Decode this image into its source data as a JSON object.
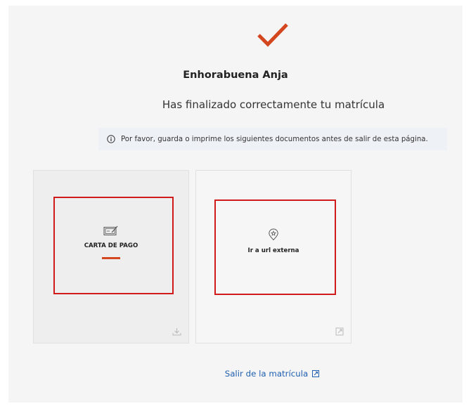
{
  "header": {
    "check_icon": "check-icon",
    "title": "Enhorabuena Anja",
    "subtitle": "Has finalizado correctamente tu matrícula"
  },
  "info_banner": {
    "icon": "info-icon",
    "text": "Por favor, guarda o imprime los siguientes documentos antes de salir de esta página."
  },
  "cards": [
    {
      "label": "CARTA DE PAGO",
      "icon": "document-edit-icon",
      "corner_icon": "download-icon",
      "accent": "#d3461e"
    },
    {
      "label": "Ir a url externa",
      "icon": "badge-star-icon",
      "corner_icon": "external-link-icon"
    }
  ],
  "footer": {
    "exit_label": "Salir de la matrícula",
    "exit_icon": "external-link-icon"
  },
  "colors": {
    "accent": "#d3461e",
    "link": "#1f5fb0",
    "highlight": "#d11a1a"
  }
}
